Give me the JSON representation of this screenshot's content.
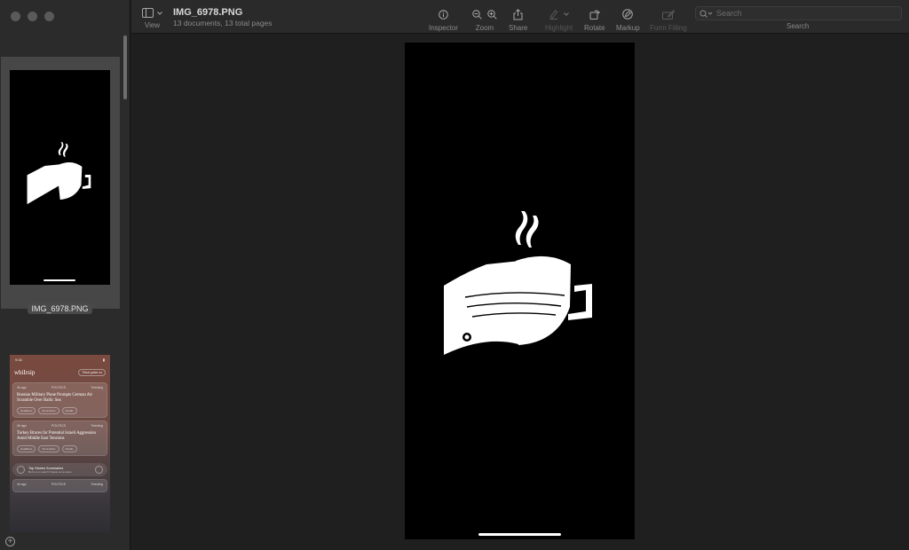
{
  "window": {
    "title": "IMG_6978.PNG",
    "subtitle": "13 documents, 13 total pages"
  },
  "toolbar": {
    "view_label": "View",
    "inspector_label": "Inspector",
    "zoom_label": "Zoom",
    "share_label": "Share",
    "highlight_label": "Highlight",
    "rotate_label": "Rotate",
    "markup_label": "Markup",
    "form_filling_label": "Form Filling",
    "search_label": "Search",
    "search_placeholder": "Search"
  },
  "sidebar": {
    "thumbnails": [
      {
        "label": "IMG_6978.PNG",
        "selected": true
      }
    ],
    "thumb2": {
      "status_time": "9:16",
      "logo": "whiIrsip",
      "pill": "Tribal guide us",
      "cards": [
        {
          "age": "4h ago",
          "category": "POLITICS",
          "tag": "Trending",
          "title": "Russian Military Plane Prompts German Air Scramble Over Baltic Sea",
          "actions": [
            "Headlines",
            "Summaries",
            "Details"
          ]
        },
        {
          "age": "4h ago",
          "category": "POLITICS",
          "tag": "Trending",
          "title": "Turkey Braces for Potential Israeli Aggression Amid Middle East Tensions",
          "actions": [
            "Headlines",
            "Summaries",
            "Details"
          ]
        }
      ],
      "summary": {
        "title": "Top Stories Summaries",
        "subtitle": "Be here to watch 5 latest summaries"
      },
      "footer": {
        "age": "4h ago",
        "category": "POLITICS",
        "tag": "Trending"
      }
    }
  },
  "colors": {
    "sidebar_bg": "#2b2b2b",
    "canvas_bg": "#1f1f1f",
    "page_bg": "#000000",
    "logo_fill": "#ffffff"
  }
}
